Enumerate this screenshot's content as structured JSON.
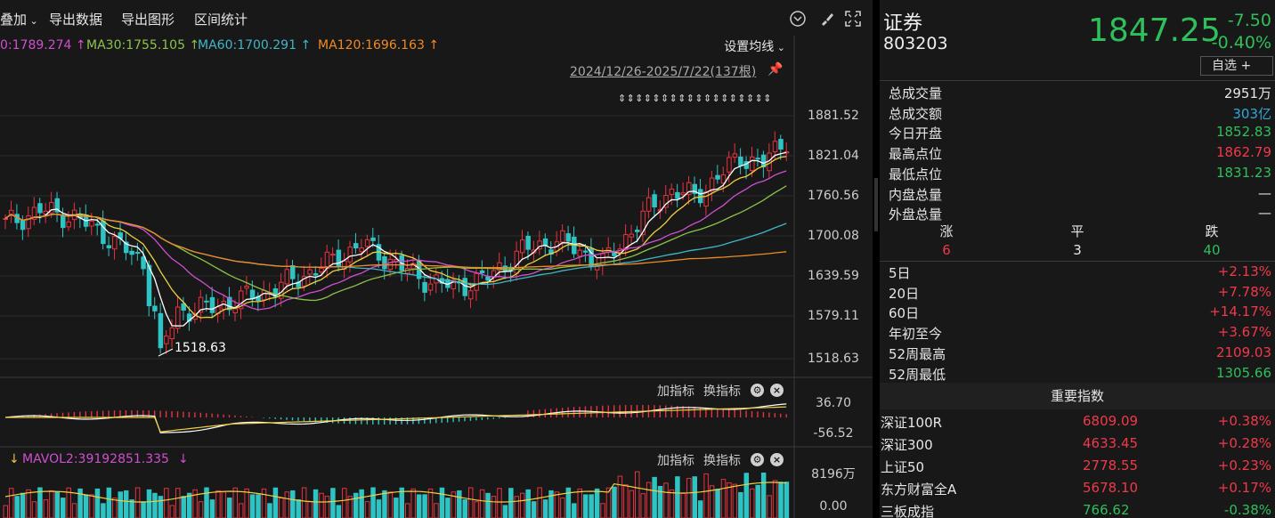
{
  "toolbar": {
    "overlay_label": "叠加",
    "export_data_label": "导出数据",
    "export_chart_label": "导出图形",
    "range_stats_label": "区间统计"
  },
  "ma": {
    "ma_partial": "0:1789.274 ↑",
    "ma30": "MA30:1755.105 ↑",
    "ma60": "MA60:1700.291 ↑",
    "ma120": "MA120:1696.163 ↑",
    "settings_label": "设置均线",
    "date_range": "2024/12/26-2025/7/22(137根)",
    "low_marker": "1518.63",
    "colors": {
      "ma20": "#d04fd0",
      "ma30": "#8bc34a",
      "ma60": "#3fb6c9",
      "ma120": "#f08a24"
    }
  },
  "price_axis": [
    "1881.52",
    "1821.04",
    "1760.56",
    "1700.08",
    "1639.59",
    "1579.11",
    "1518.63"
  ],
  "macd_panel": {
    "add_indicator": "加指标",
    "switch_indicator": "换指标",
    "top_value": "36.70",
    "bottom_value": "-56.52"
  },
  "vol_panel": {
    "mavol_label": "MAVOL2:39192851.335",
    "add_indicator": "加指标",
    "switch_indicator": "换指标",
    "top_value": "8196万",
    "bottom_value": "0.00"
  },
  "quote": {
    "name": "证券",
    "code": "803203",
    "price": "1847.25",
    "change": "-7.50",
    "change_pct": "-0.40%",
    "watchlist_label": "自选 +"
  },
  "stats": [
    {
      "label": "总成交量",
      "value": "2951万",
      "color": "white"
    },
    {
      "label": "总成交额",
      "value": "303亿",
      "color": "cyan"
    },
    {
      "label": "今日开盘",
      "value": "1852.83",
      "color": "green"
    },
    {
      "label": "最高点位",
      "value": "1862.79",
      "color": "red"
    },
    {
      "label": "最低点位",
      "value": "1831.23",
      "color": "green"
    },
    {
      "label": "内盘总量",
      "value": "—",
      "color": "white"
    },
    {
      "label": "外盘总量",
      "value": "—",
      "color": "white"
    }
  ],
  "breadth": {
    "up_label": "涨",
    "flat_label": "平",
    "down_label": "跌",
    "up": "6",
    "flat": "3",
    "down": "40"
  },
  "periods": [
    {
      "label": "5日",
      "value": "+2.13%",
      "color": "red"
    },
    {
      "label": "20日",
      "value": "+7.78%",
      "color": "red"
    },
    {
      "label": "60日",
      "value": "+14.17%",
      "color": "red"
    },
    {
      "label": "年初至今",
      "value": "+3.67%",
      "color": "red"
    },
    {
      "label": "52周最高",
      "value": "2109.03",
      "color": "red"
    },
    {
      "label": "52周最低",
      "value": "1305.66",
      "color": "green"
    }
  ],
  "index_title": "重要指数",
  "indices": [
    {
      "name": "深证100R",
      "value": "6809.09",
      "pct": "+0.38%",
      "color": "red"
    },
    {
      "name": "深证300",
      "value": "4633.45",
      "pct": "+0.28%",
      "color": "red"
    },
    {
      "name": "上证50",
      "value": "2778.55",
      "pct": "+0.23%",
      "color": "red"
    },
    {
      "name": "东方财富全A",
      "value": "5678.10",
      "pct": "+0.17%",
      "color": "red"
    },
    {
      "name": "三板成指",
      "value": "766.62",
      "pct": "-0.38%",
      "color": "green"
    }
  ],
  "chart_data": {
    "type": "candlestick",
    "y_range": [
      1518.63,
      1881.52
    ],
    "low_point": 1518.63,
    "last_close": 1847.25
  }
}
